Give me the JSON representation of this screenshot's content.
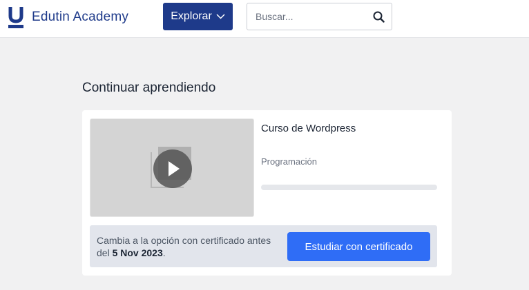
{
  "header": {
    "brand": "Edutin Academy",
    "explore_label": "Explorar",
    "search_placeholder": "Buscar..."
  },
  "main": {
    "section_title": "Continuar aprendiendo",
    "course": {
      "title": "Curso de Wordpress",
      "category": "Programación",
      "progress": 0
    },
    "banner": {
      "text_before": "Cambia a la opción con certificado antes del ",
      "deadline": "5 Nov 2023",
      "text_after": ".",
      "button_label": "Estudiar con certificado"
    }
  },
  "colors": {
    "brand_navy": "#1e3a8a",
    "accent_blue": "#2f6df6",
    "page_bg": "#f1f1f2"
  }
}
